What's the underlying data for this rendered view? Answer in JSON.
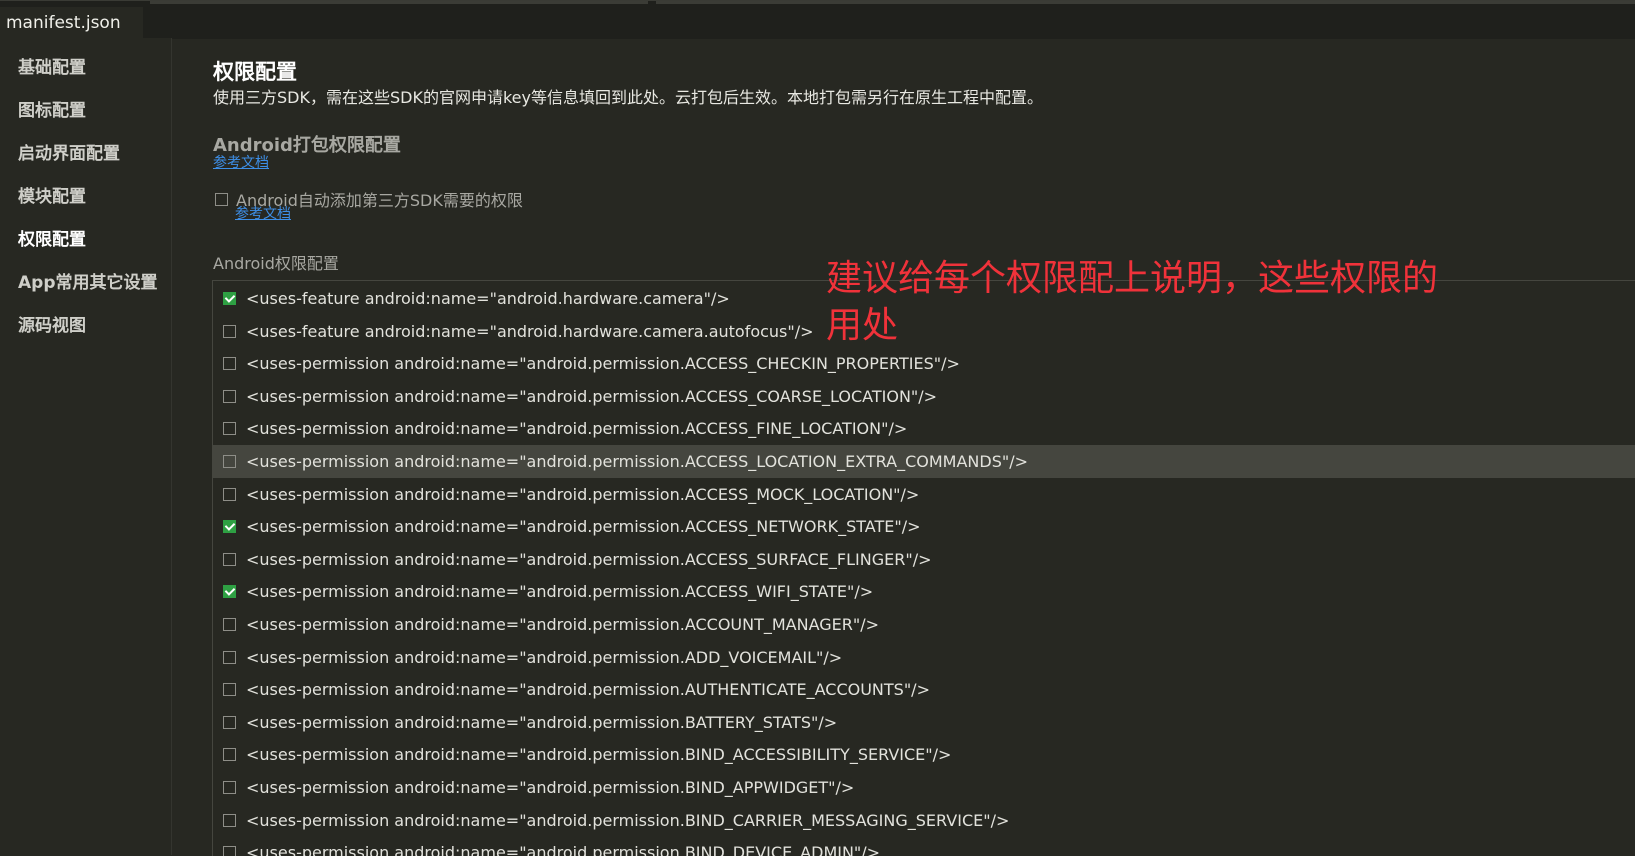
{
  "editor": {
    "tab_label": "manifest.json"
  },
  "sidebar": {
    "items": [
      {
        "label": "基础配置",
        "active": false
      },
      {
        "label": "图标配置",
        "active": false
      },
      {
        "label": "启动界面配置",
        "active": false
      },
      {
        "label": "模块配置",
        "active": false
      },
      {
        "label": "权限配置",
        "active": true
      },
      {
        "label": "App常用其它设置",
        "active": false
      },
      {
        "label": "源码视图",
        "active": false
      }
    ]
  },
  "main": {
    "title": "权限配置",
    "description": "使用三方SDK，需在这些SDK的官网申请key等信息填回到此处。云打包后生效。本地打包需另行在原生工程中配置。",
    "section_title": "Android打包权限配置",
    "ref_link_1": "参考文档",
    "auto_add_label": "Android自动添加第三方SDK需要的权限",
    "auto_add_checked": false,
    "ref_link_2": "参考文档",
    "list_label": "Android权限配置",
    "permissions": [
      {
        "text": "<uses-feature android:name=\"android.hardware.camera\"/>",
        "checked": true
      },
      {
        "text": "<uses-feature android:name=\"android.hardware.camera.autofocus\"/>",
        "checked": false
      },
      {
        "text": "<uses-permission android:name=\"android.permission.ACCESS_CHECKIN_PROPERTIES\"/>",
        "checked": false
      },
      {
        "text": "<uses-permission android:name=\"android.permission.ACCESS_COARSE_LOCATION\"/>",
        "checked": false
      },
      {
        "text": "<uses-permission android:name=\"android.permission.ACCESS_FINE_LOCATION\"/>",
        "checked": false
      },
      {
        "text": "<uses-permission android:name=\"android.permission.ACCESS_LOCATION_EXTRA_COMMANDS\"/>",
        "checked": false,
        "hover": true
      },
      {
        "text": "<uses-permission android:name=\"android.permission.ACCESS_MOCK_LOCATION\"/>",
        "checked": false
      },
      {
        "text": "<uses-permission android:name=\"android.permission.ACCESS_NETWORK_STATE\"/>",
        "checked": true
      },
      {
        "text": "<uses-permission android:name=\"android.permission.ACCESS_SURFACE_FLINGER\"/>",
        "checked": false
      },
      {
        "text": "<uses-permission android:name=\"android.permission.ACCESS_WIFI_STATE\"/>",
        "checked": true
      },
      {
        "text": "<uses-permission android:name=\"android.permission.ACCOUNT_MANAGER\"/>",
        "checked": false
      },
      {
        "text": "<uses-permission android:name=\"android.permission.ADD_VOICEMAIL\"/>",
        "checked": false
      },
      {
        "text": "<uses-permission android:name=\"android.permission.AUTHENTICATE_ACCOUNTS\"/>",
        "checked": false
      },
      {
        "text": "<uses-permission android:name=\"android.permission.BATTERY_STATS\"/>",
        "checked": false
      },
      {
        "text": "<uses-permission android:name=\"android.permission.BIND_ACCESSIBILITY_SERVICE\"/>",
        "checked": false
      },
      {
        "text": "<uses-permission android:name=\"android.permission.BIND_APPWIDGET\"/>",
        "checked": false
      },
      {
        "text": "<uses-permission android:name=\"android.permission.BIND_CARRIER_MESSAGING_SERVICE\"/>",
        "checked": false
      },
      {
        "text": "<uses-permission android:name=\"android.permission.BIND_DEVICE_ADMIN\"/>",
        "checked": false
      }
    ]
  },
  "annotation": {
    "text": "建议给每个权限配上说明，这些权限的用处",
    "color": "#f0323a"
  },
  "colors": {
    "background": "#272822",
    "link": "#3d8ee6",
    "check_green": "#2ea043"
  }
}
